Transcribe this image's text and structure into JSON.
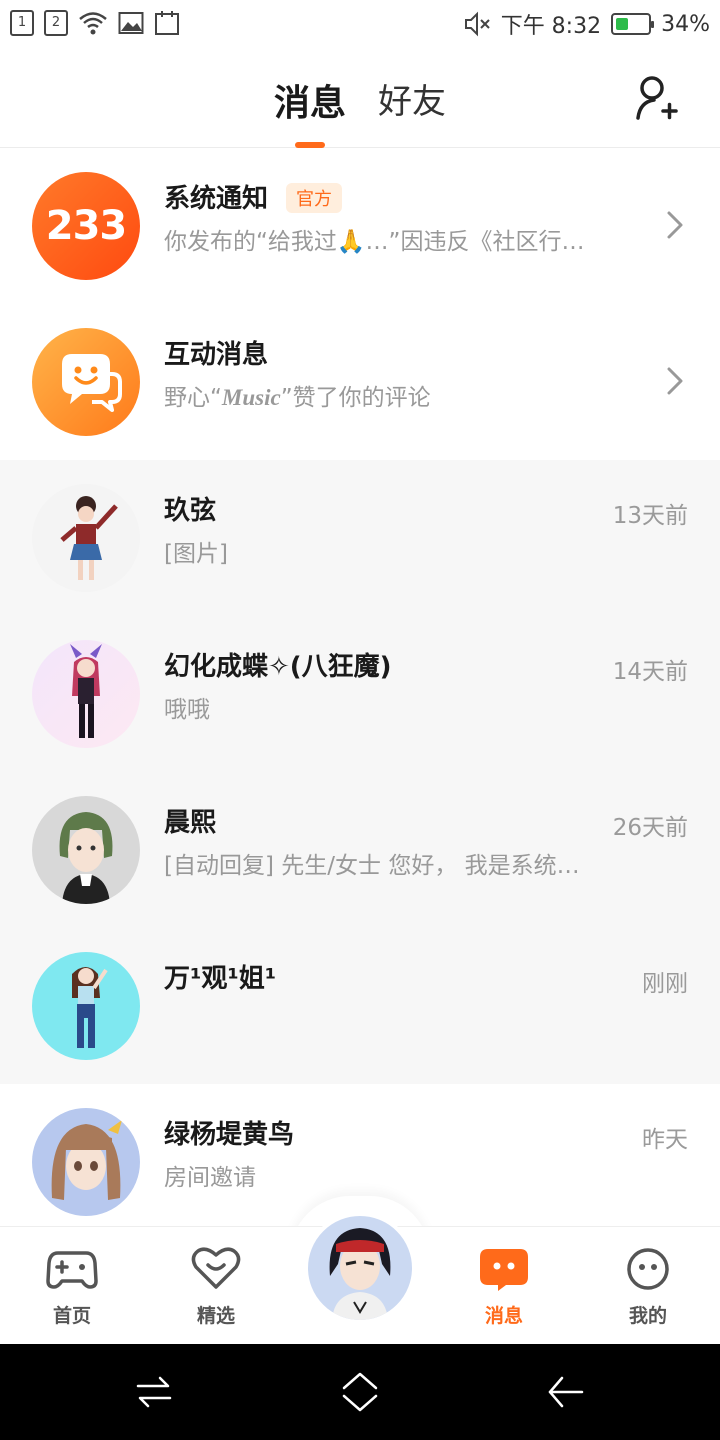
{
  "status_bar": {
    "time": "下午 8:32",
    "battery": "34%",
    "battery_level": 0.34,
    "sim1": "1",
    "sim2": "2"
  },
  "header": {
    "tabs": [
      {
        "label": "消息",
        "active": true
      },
      {
        "label": "好友",
        "active": false
      }
    ],
    "accent": "#ff6a1a"
  },
  "system_rows": [
    {
      "name": "系统通知",
      "badge": "官方",
      "subtitle": "你发布的“给我过🙏…”因违反《社区行…",
      "avatar_text": "233"
    },
    {
      "name": "互动消息",
      "subtitle_prefix": "野心“",
      "subtitle_music": "Music",
      "subtitle_suffix": "”赞了你的评论"
    }
  ],
  "conversations": [
    {
      "name": "玖弦",
      "preview": "[图片]",
      "time": "13天前"
    },
    {
      "name": "幻化成蝶✧(八狂魔)",
      "preview": "哦哦",
      "time": "14天前"
    },
    {
      "name": "晨熙",
      "preview": "[自动回复] 先生/女士   您好，  我是系统…",
      "time": "26天前"
    },
    {
      "name": "万¹观¹姐¹",
      "preview": "",
      "time": "刚刚"
    },
    {
      "name": "绿杨堤黄鸟",
      "preview": "房间邀请",
      "time": "昨天"
    }
  ],
  "bottom_nav": [
    {
      "label": "首页",
      "icon": "gamepad-icon"
    },
    {
      "label": "精选",
      "icon": "heart-chat-icon"
    },
    {
      "label": "消息",
      "icon": "message-icon",
      "active": true
    },
    {
      "label": "我的",
      "icon": "face-icon"
    }
  ]
}
